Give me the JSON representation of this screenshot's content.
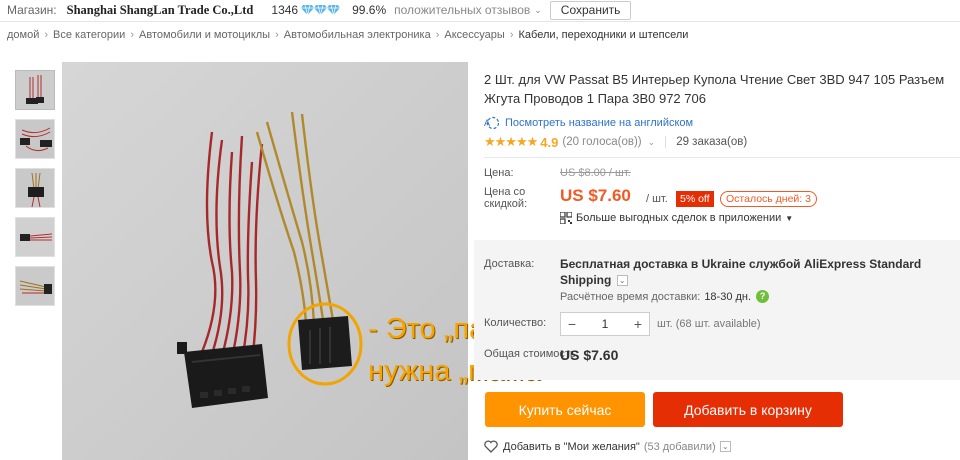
{
  "store": {
    "label": "Магазин:",
    "name": "Shanghai ShangLan Trade Co.,Ltd",
    "score": "1346",
    "diamond_count": 3,
    "diamond_color": "#5ab4e8",
    "positive_pct": "99.6%",
    "positive_label": "положительных отзывов",
    "save_label": "Сохранить"
  },
  "breadcrumb": [
    "домой",
    "Все категории",
    "Автомобили и мотоциклы",
    "Автомобильная электроника",
    "Аксессуары",
    "Кабели, переходники и штепсели"
  ],
  "product": {
    "title": "2 Шт. для VW Passat B5 Интерьер Купола Чтение Свет 3BD 947 105 Разъем Жгута Проводов 1 Пара 3B0 972 706",
    "translate_label": "Посмотреть название на английском",
    "stars": "★★★★★",
    "rating": "4.9",
    "votes": "(20 голоса(ов))",
    "orders": "29 заказа(ов)"
  },
  "price": {
    "label": "Цена:",
    "old": "US $8.00 / шт.",
    "discount_label": "Цена со скидкой:",
    "new": "US $7.60",
    "unit": "/ шт.",
    "off": "5% off",
    "days_left": "Осталось дней: 3",
    "app_deals": "Больше выгодных сделок в приложении"
  },
  "shipping": {
    "label": "Доставка:",
    "text": "Бесплатная доставка в Ukraine службой AliExpress Standard Shipping",
    "time_label": "Расчётное время доставки:",
    "time_value": "18-30 дн.",
    "help": "?"
  },
  "quantity": {
    "label": "Количество:",
    "value": "1",
    "minus": "−",
    "plus": "+",
    "note": "шт. (68 шт. available)"
  },
  "total": {
    "label": "Общая стоимость:",
    "value": "US $7.60"
  },
  "buttons": {
    "buy": "Купить сейчас",
    "cart": "Добавить в корзину"
  },
  "wishlist": {
    "label": "Добавить в \"Мои желания\"",
    "count": "(53 добавили)"
  },
  "annotation": {
    "line1": "- Это „папа“",
    "line2": "нужна „мама“",
    "color": "#f7a400"
  },
  "colors": {
    "accent_orange": "#ff9400",
    "accent_red": "#e62e04",
    "price_color": "#f15a24",
    "link_blue": "#2e72c9"
  }
}
